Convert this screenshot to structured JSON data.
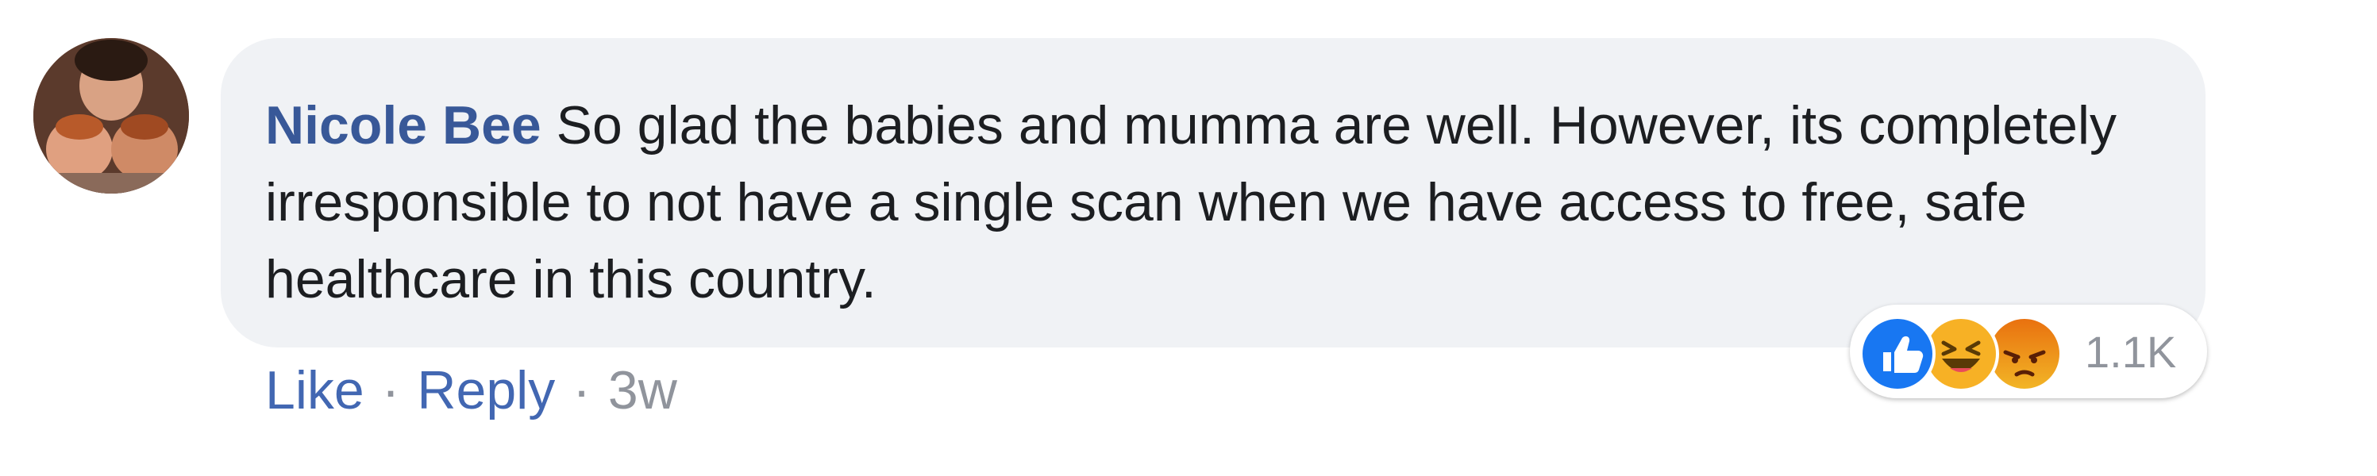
{
  "comment": {
    "author": "Nicole Bee",
    "text": "So glad the babies and mumma are well. However, its completely irresponsible to not have a single scan when we have access to free, safe healthcare in this country.",
    "actions": {
      "like_label": "Like",
      "reply_label": "Reply",
      "timestamp": "3w",
      "separator": "·"
    },
    "reactions": {
      "icons": [
        "like-icon",
        "haha-icon",
        "angry-icon"
      ],
      "count": "1.1K"
    }
  },
  "colors": {
    "author": "#385898",
    "link": "#4267b2",
    "bubble": "#f0f2f5",
    "like": "#1877f2",
    "haha": "#f7b125",
    "angry": "#e9710f"
  }
}
